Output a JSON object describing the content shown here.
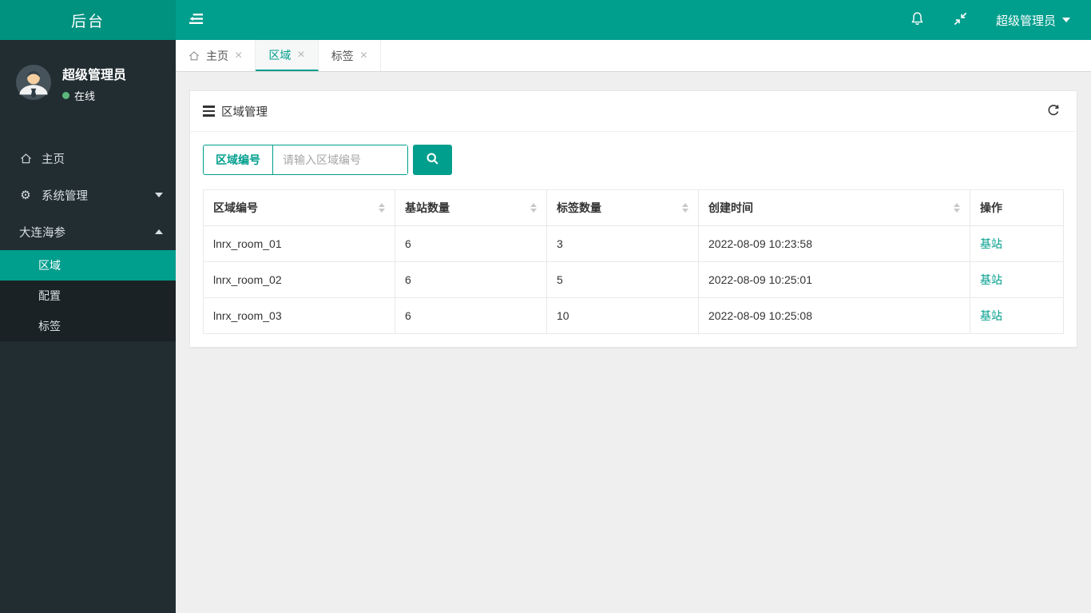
{
  "topbar": {
    "brand": "后台",
    "user_label": "超级管理员"
  },
  "sidebar": {
    "user_name": "超级管理员",
    "user_status": "在线",
    "menu": [
      {
        "label": "主页",
        "icon": "home-icon"
      },
      {
        "label": "系统管理",
        "icon": "gear-icon"
      },
      {
        "label": "大连海参",
        "icon": "none"
      }
    ],
    "submenu": [
      {
        "label": "区域",
        "active": true
      },
      {
        "label": "配置",
        "active": false
      },
      {
        "label": "标签",
        "active": false
      }
    ]
  },
  "tabs": [
    {
      "label": "主页",
      "active": false,
      "icon": "home-icon"
    },
    {
      "label": "区域",
      "active": true
    },
    {
      "label": "标签",
      "active": false
    }
  ],
  "panel": {
    "title": "区域管理"
  },
  "search": {
    "field_label": "区域编号",
    "placeholder": "请输入区域编号",
    "value": ""
  },
  "table": {
    "headers": [
      "区域编号",
      "基站数量",
      "标签数量",
      "创建时间",
      "操作"
    ],
    "rows": [
      [
        "lnrx_room_01",
        "6",
        "3",
        "2022-08-09 10:23:58",
        "基站"
      ],
      [
        "lnrx_room_02",
        "6",
        "5",
        "2022-08-09 10:25:01",
        "基站"
      ],
      [
        "lnrx_room_03",
        "6",
        "10",
        "2022-08-09 10:25:08",
        "基站"
      ]
    ]
  },
  "icons": {
    "close_glyph": "×",
    "gear_glyph": "⚙"
  },
  "colors": {
    "navbar_teal": "#009e8d",
    "logo_teal": "#00917f",
    "sidebar_bg": "#222d32",
    "submenu_bg": "#1a2226",
    "accent": "#009e8d",
    "online_dot": "#5cb87a"
  }
}
